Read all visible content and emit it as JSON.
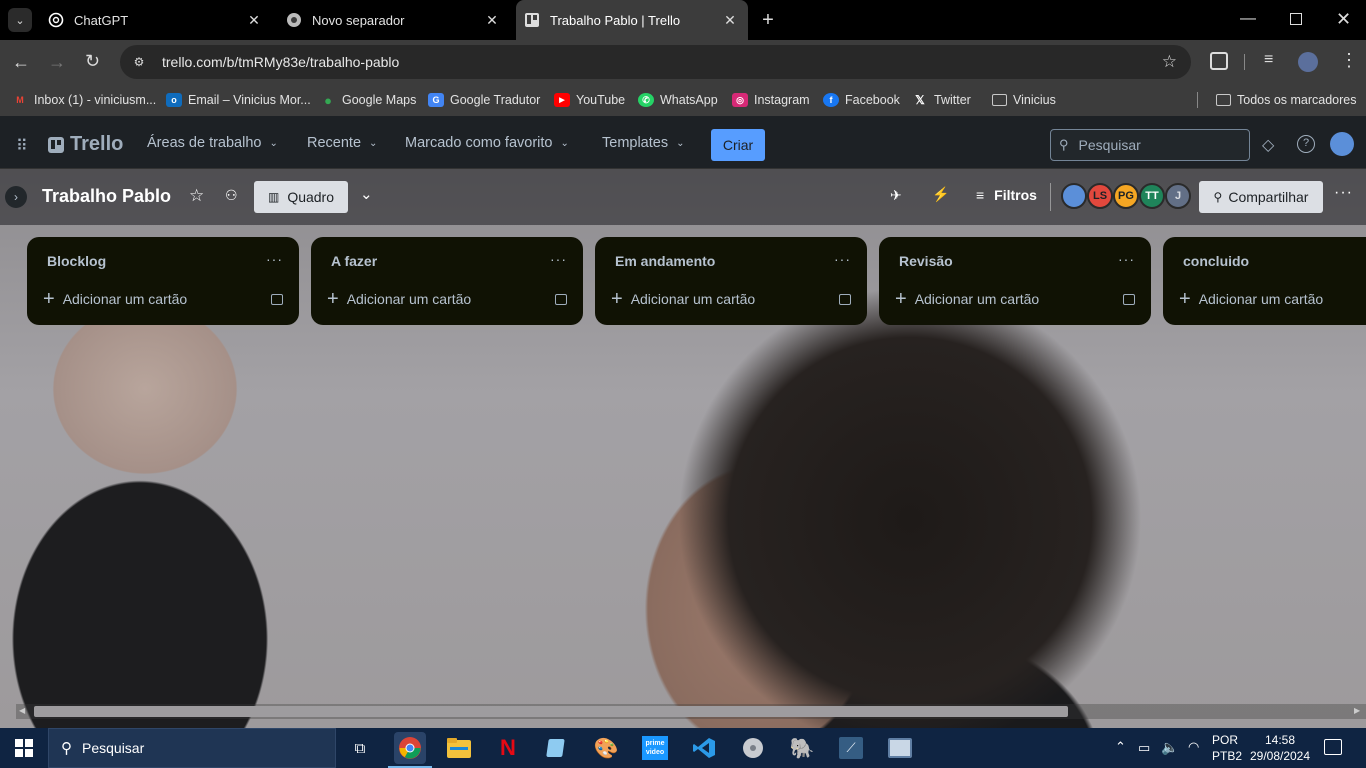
{
  "browser": {
    "tabs": [
      {
        "title": "ChatGPT",
        "icon": "chatgpt-icon"
      },
      {
        "title": "Novo separador",
        "icon": "chrome-icon"
      },
      {
        "title": "Trabalho Pablo | Trello",
        "icon": "trello-icon",
        "active": true
      }
    ],
    "url": "trello.com/b/tmRMy83e/trabalho-pablo",
    "bookmarks": [
      {
        "label": "Inbox (1) - viniciusm...",
        "icon": "gmail-icon",
        "color": "#ea4335"
      },
      {
        "label": "Email – Vinicius Mor...",
        "icon": "outlook-icon",
        "color": "#0f6cbd"
      },
      {
        "label": "Google Maps",
        "icon": "maps-icon",
        "color": "#34a853"
      },
      {
        "label": "Google Tradutor",
        "icon": "translate-icon",
        "color": "#4285f4"
      },
      {
        "label": "YouTube",
        "icon": "youtube-icon",
        "color": "#ff0000"
      },
      {
        "label": "WhatsApp",
        "icon": "whatsapp-icon",
        "color": "#25d366"
      },
      {
        "label": "Instagram",
        "icon": "instagram-icon",
        "color": "#d62976"
      },
      {
        "label": "Facebook",
        "icon": "facebook-icon",
        "color": "#1877f2"
      },
      {
        "label": "Twitter",
        "icon": "x-icon",
        "color": "#000000"
      },
      {
        "label": "Vinicius",
        "icon": "folder-icon",
        "color": "#c8c8c8"
      }
    ],
    "all_bookmarks": "Todos os marcadores"
  },
  "trello": {
    "logo": "Trello",
    "menus": [
      "Áreas de trabalho",
      "Recente",
      "Marcado como favorito",
      "Templates"
    ],
    "create_label": "Criar",
    "search_placeholder": "Pesquisar",
    "board": {
      "title": "Trabalho Pablo",
      "view_label": "Quadro",
      "filters_label": "Filtros",
      "share_label": "Compartilhar",
      "members": [
        {
          "initials": "",
          "color": "#5b8fd9"
        },
        {
          "initials": "LS",
          "color": "#e2483d"
        },
        {
          "initials": "PG",
          "color": "#f5a623"
        },
        {
          "initials": "TT",
          "color": "#1f845a"
        },
        {
          "initials": "J",
          "color": "#626f86"
        }
      ],
      "lists": [
        {
          "title": "Blocklog",
          "add_label": "Adicionar um cartão"
        },
        {
          "title": "A fazer",
          "add_label": "Adicionar um cartão"
        },
        {
          "title": "Em andamento",
          "add_label": "Adicionar um cartão"
        },
        {
          "title": "Revisão",
          "add_label": "Adicionar um cartão"
        },
        {
          "title": "concluido",
          "add_label": "Adicionar um cartão"
        }
      ]
    }
  },
  "taskbar": {
    "search_placeholder": "Pesquisar",
    "lang": "POR",
    "layout": "PTB2",
    "time": "14:58",
    "date": "29/08/2024"
  }
}
